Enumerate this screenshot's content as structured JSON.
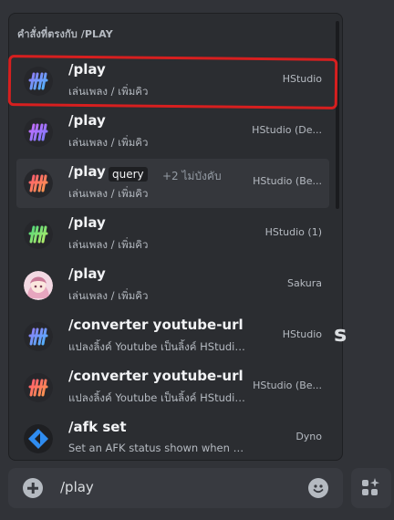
{
  "popup": {
    "header": "คำสั่งที่ตรงกับ /PLAY",
    "items": [
      {
        "command": "/play",
        "description": "เล่นเพลง / เพิ่มคิว",
        "source": "HStudio",
        "avatar": "hstudio-icon",
        "colors": [
          "#8f7cf7",
          "#4fb6ff"
        ]
      },
      {
        "command": "/play",
        "description": "เล่นเพลง / เพิ่มคิว",
        "source": "HStudio (De...",
        "avatar": "hstudio-icon",
        "colors": [
          "#c86bff",
          "#7a7cff"
        ]
      },
      {
        "command": "/play",
        "option": "query",
        "more": "+2 ไม่บังคับ",
        "description": "เล่นเพลง / เพิ่มคิว",
        "source": "HStudio (Be...",
        "avatar": "hstudio-icon",
        "colors": [
          "#ff5a6e",
          "#ff9a4f"
        ]
      },
      {
        "command": "/play",
        "description": "เล่นเพลง / เพิ่มคิว",
        "source": "HStudio (1)",
        "avatar": "hstudio-icon",
        "colors": [
          "#4fd67a",
          "#b8f06a"
        ]
      },
      {
        "command": "/play",
        "description": "เล่นเพลง / เพิ่มคิว",
        "source": "Sakura",
        "avatar": "sakura-avatar"
      },
      {
        "command": "/converter youtube-url",
        "description": "แปลงลิ้งค์ Youtube เป็นลิ้งค์ HStudio ...",
        "source": "HStudio",
        "avatar": "hstudio-icon",
        "colors": [
          "#8f7cf7",
          "#4fb6ff"
        ]
      },
      {
        "command": "/converter youtube-url",
        "description": "แปลงลิ้งค์ Youtube เป็นลิ้งค์ HStudio ...",
        "source": "HStudio (Be...",
        "avatar": "hstudio-icon",
        "colors": [
          "#ff5a6e",
          "#ff9a4f"
        ]
      },
      {
        "command": "/afk set",
        "description": "Set an AFK status shown when you'...",
        "source": "Dyno",
        "avatar": "dyno-icon"
      }
    ]
  },
  "chat": {
    "input_value": "/play"
  },
  "colors": {
    "highlight": "#d71f1f",
    "selected_row": "#35373c"
  }
}
